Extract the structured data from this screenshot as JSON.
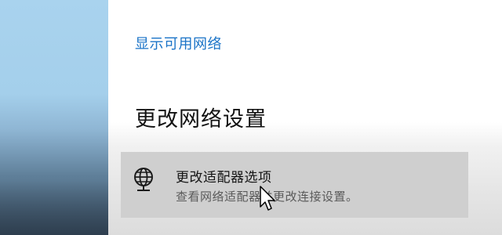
{
  "network": {
    "show_available_link": "显示可用网络"
  },
  "change_settings": {
    "heading": "更改网络设置",
    "options": [
      {
        "icon": "globe-network-icon",
        "title": "更改适配器选项",
        "description": "查看网络适配器并更改连接设置。"
      }
    ]
  },
  "colors": {
    "link": "#1a73c7",
    "option_background": "#cfcfcf"
  }
}
